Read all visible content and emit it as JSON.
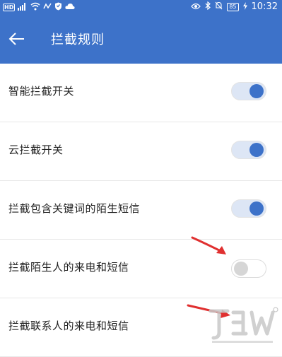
{
  "status_bar": {
    "hd": "HD",
    "battery": "85",
    "time": "10:32"
  },
  "app_bar": {
    "title": "拦截规则"
  },
  "settings": [
    {
      "label": "智能拦截开关",
      "toggle_on": true
    },
    {
      "label": "云拦截开关",
      "toggle_on": true
    },
    {
      "label": "拦截包含关键词的陌生短信",
      "toggle_on": true
    },
    {
      "label": "拦截陌生人的来电和短信",
      "toggle_on": false
    },
    {
      "label": "拦截联系人的来电和短信",
      "toggle_on": false
    }
  ],
  "colors": {
    "accent": "#3d72c9",
    "annotation_arrow": "#e03030"
  }
}
